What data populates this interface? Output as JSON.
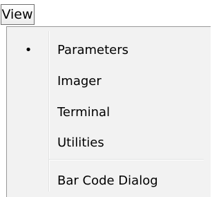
{
  "menubar": {
    "active_menu_label": "View"
  },
  "menu": {
    "items": [
      {
        "label": "Parameters",
        "checked": true,
        "check_mark": "•"
      },
      {
        "label": "Imager",
        "checked": false
      },
      {
        "label": "Terminal",
        "checked": false
      },
      {
        "label": "Utilities",
        "checked": false
      }
    ],
    "items_after_separator": [
      {
        "label": "Bar Code Dialog",
        "checked": false
      }
    ]
  },
  "colors": {
    "menu_background": "#f2f2f2",
    "menu_border": "#979797",
    "menubar_item_border": "#6f6f6f",
    "text": "#000000"
  }
}
